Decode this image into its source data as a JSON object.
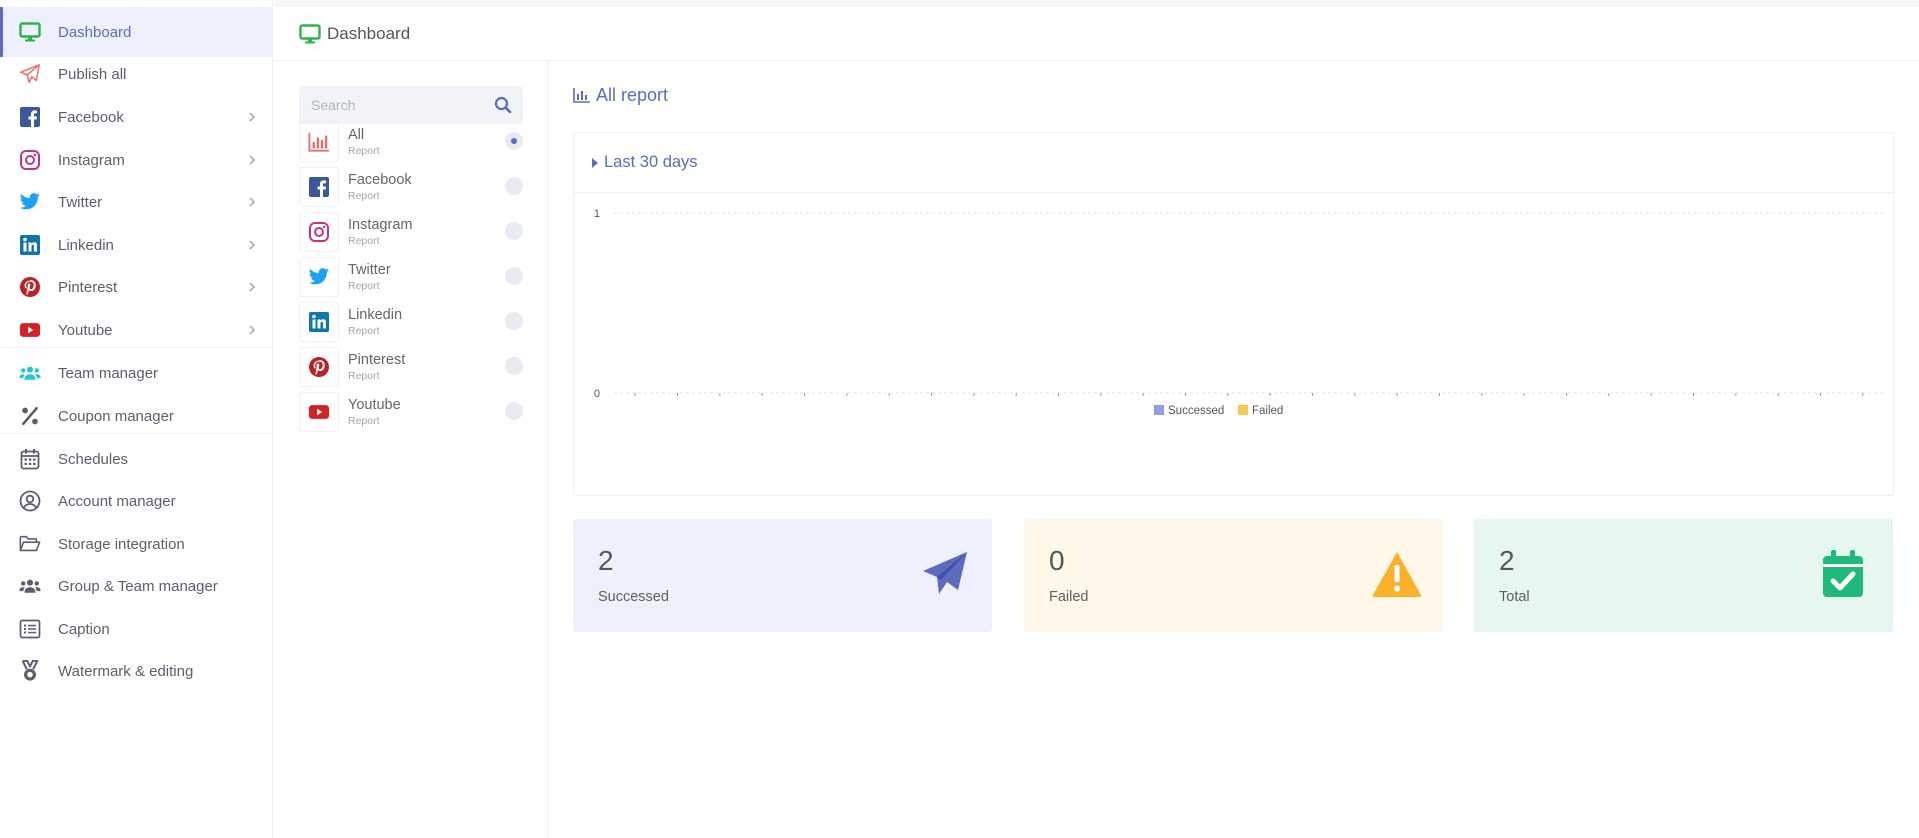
{
  "sidebar": {
    "items": [
      {
        "label": "Dashboard",
        "icon": "monitor-icon",
        "active": true
      },
      {
        "label": "Publish all",
        "icon": "paper-plane-icon"
      },
      {
        "label": "Facebook",
        "icon": "facebook-icon",
        "submenu": true
      },
      {
        "label": "Instagram",
        "icon": "instagram-icon",
        "submenu": true
      },
      {
        "label": "Twitter",
        "icon": "twitter-icon",
        "submenu": true
      },
      {
        "label": "Linkedin",
        "icon": "linkedin-icon",
        "submenu": true
      },
      {
        "label": "Pinterest",
        "icon": "pinterest-icon",
        "submenu": true
      },
      {
        "label": "Youtube",
        "icon": "youtube-icon",
        "submenu": true
      },
      {
        "label": "Team manager",
        "icon": "users-icon"
      },
      {
        "label": "Coupon manager",
        "icon": "percent-icon"
      },
      {
        "label": "Schedules",
        "icon": "calendar-icon"
      },
      {
        "label": "Account manager",
        "icon": "user-circle-icon"
      },
      {
        "label": "Storage integration",
        "icon": "folder-open-icon"
      },
      {
        "label": "Group & Team manager",
        "icon": "group-icon"
      },
      {
        "label": "Caption",
        "icon": "list-icon"
      },
      {
        "label": "Watermark & editing",
        "icon": "medal-icon"
      }
    ]
  },
  "header": {
    "title": "Dashboard"
  },
  "search": {
    "placeholder": "Search"
  },
  "reports": {
    "sub_label": "Report",
    "items": [
      {
        "name": "All",
        "icon": "bar-chart-icon",
        "selected": true
      },
      {
        "name": "Facebook",
        "icon": "facebook-icon",
        "selected": false
      },
      {
        "name": "Instagram",
        "icon": "instagram-icon",
        "selected": false
      },
      {
        "name": "Twitter",
        "icon": "twitter-icon",
        "selected": false
      },
      {
        "name": "Linkedin",
        "icon": "linkedin-icon",
        "selected": false
      },
      {
        "name": "Pinterest",
        "icon": "pinterest-icon",
        "selected": false
      },
      {
        "name": "Youtube",
        "icon": "youtube-icon",
        "selected": false
      }
    ]
  },
  "main": {
    "section_title": "All report",
    "range_label": "Last 30 days"
  },
  "stats": [
    {
      "value": "2",
      "label": "Successed",
      "icon": "paper-plane-icon"
    },
    {
      "value": "0",
      "label": "Failed",
      "icon": "warning-icon"
    },
    {
      "value": "2",
      "label": "Total",
      "icon": "calendar-check-icon"
    }
  ],
  "colors": {
    "accent": "#5c6bc0",
    "successed": "#8e9ee0",
    "failed": "#f8c94f",
    "total": "#1fb97a",
    "warning": "#fbb12b"
  },
  "chart_data": {
    "type": "line",
    "ylim": [
      0,
      1
    ],
    "yticks": [
      "1",
      "0"
    ],
    "x_count": 30,
    "series": [
      {
        "name": "Successed",
        "values": [
          0,
          0,
          0,
          0,
          0,
          0,
          0,
          0,
          0,
          0,
          0,
          0,
          0,
          0,
          0,
          0,
          0,
          0,
          0,
          0,
          0,
          0,
          0,
          0,
          0,
          0,
          0,
          0,
          0,
          0
        ]
      },
      {
        "name": "Failed",
        "values": [
          0,
          0,
          0,
          0,
          0,
          0,
          0,
          0,
          0,
          0,
          0,
          0,
          0,
          0,
          0,
          0,
          0,
          0,
          0,
          0,
          0,
          0,
          0,
          0,
          0,
          0,
          0,
          0,
          0,
          0
        ]
      }
    ],
    "legend": "bottom",
    "grid": true
  }
}
